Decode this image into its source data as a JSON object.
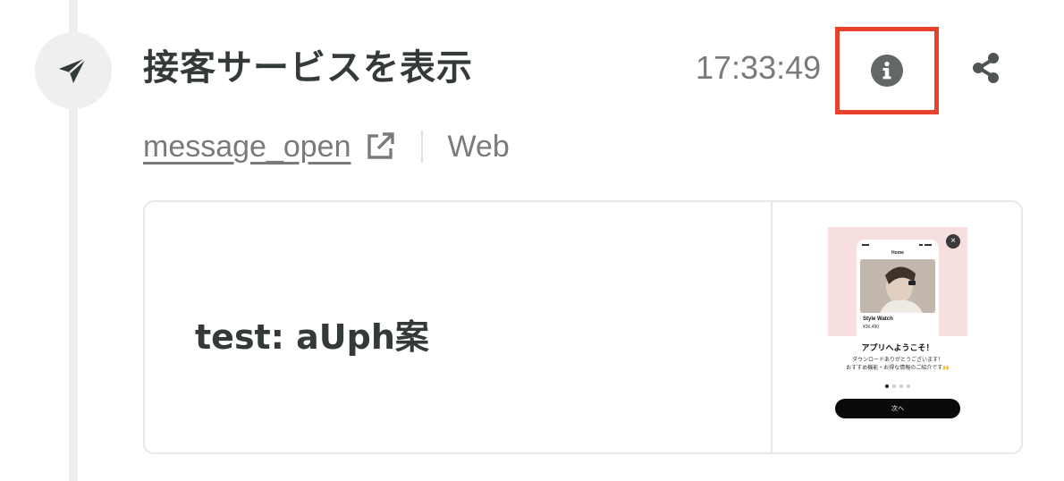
{
  "event": {
    "title": "接客サービスを表示",
    "time": "17:33:49",
    "link_text": "message_open",
    "channel": "Web",
    "icon": "paper-plane-icon"
  },
  "actions": {
    "info_icon": "info-icon",
    "share_icon": "share-icon",
    "highlight_color": "#e8412d"
  },
  "card": {
    "name": "test: aUph案",
    "preview": {
      "screen_title": "Home",
      "product_name": "Style Watch",
      "price": "¥36,490",
      "heading": "アプリへようこそ！",
      "body_line1": "ダウンロードありがとうございます！",
      "body_line2": "おすすめ機能・お得な情報のご紹介です🙌",
      "button": "次へ",
      "close_symbol": "×"
    }
  }
}
